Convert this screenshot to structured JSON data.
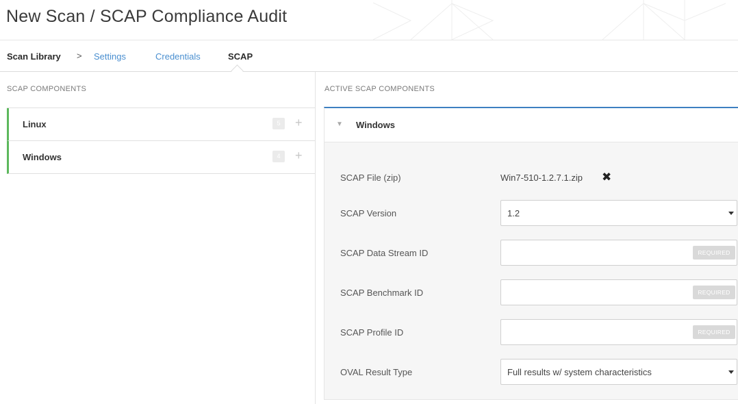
{
  "header": {
    "title": "New Scan / SCAP Compliance Audit"
  },
  "nav": {
    "root": "Scan Library",
    "separator": ">",
    "links": [
      "Settings",
      "Credentials"
    ],
    "active": "SCAP"
  },
  "left": {
    "section_title": "SCAP COMPONENTS",
    "components": [
      {
        "name": "Linux",
        "count": "5",
        "add": "+"
      },
      {
        "name": "Windows",
        "count": "4",
        "add": "+"
      }
    ]
  },
  "right": {
    "section_title": "ACTIVE SCAP COMPONENTS",
    "card": {
      "toggle_icon": "triangle-down-icon",
      "title": "Windows",
      "fields": {
        "file_label": "SCAP File (zip)",
        "file_value": "Win7-510-1.2.7.1.zip",
        "file_remove_icon": "close-icon",
        "version_label": "SCAP Version",
        "version_value": "1.2",
        "datastream_label": "SCAP Data Stream ID",
        "benchmark_label": "SCAP Benchmark ID",
        "profile_label": "SCAP Profile ID",
        "required": "REQUIRED",
        "oval_label": "OVAL Result Type",
        "oval_value": "Full results w/ system characteristics"
      }
    }
  },
  "colors": {
    "accent_blue": "#3d7fc1",
    "link_blue": "#4a8fd0",
    "component_green": "#5cb85c"
  }
}
